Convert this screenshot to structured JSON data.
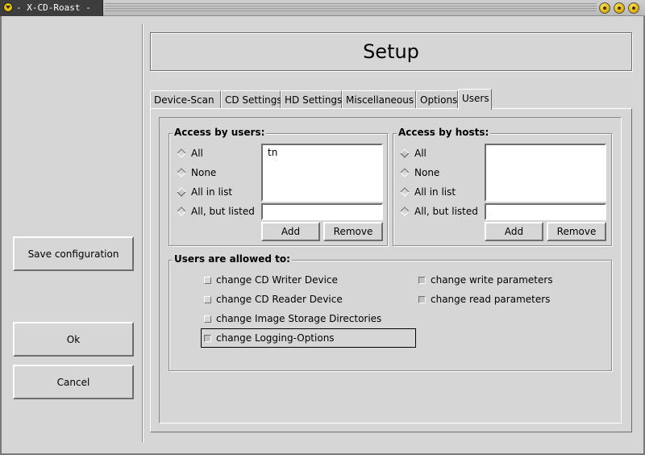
{
  "window": {
    "title": "- X-CD-Roast -"
  },
  "left_panel": {
    "save_label": "Save configuration",
    "ok_label": "Ok",
    "cancel_label": "Cancel"
  },
  "header": {
    "title": "Setup"
  },
  "tabs": [
    {
      "label": "Device-Scan",
      "active": false
    },
    {
      "label": "CD Settings",
      "active": false
    },
    {
      "label": "HD Settings",
      "active": false
    },
    {
      "label": "Miscellaneous",
      "active": false
    },
    {
      "label": "Options",
      "active": false
    },
    {
      "label": "Users",
      "active": true
    }
  ],
  "access_users": {
    "label": "Access by users:",
    "options": [
      "All",
      "None",
      "All in list",
      "All, but listed"
    ],
    "selected": "All in list",
    "list": [
      "tn"
    ],
    "entry_value": "",
    "add_label": "Add",
    "remove_label": "Remove"
  },
  "access_hosts": {
    "label": "Access by hosts:",
    "options": [
      "All",
      "None",
      "All in list",
      "All, but listed"
    ],
    "selected": "All",
    "list": [],
    "entry_value": "",
    "add_label": "Add",
    "remove_label": "Remove"
  },
  "permissions": {
    "label": "Users are allowed to:",
    "items": [
      {
        "label": "change CD Writer Device",
        "checked": false
      },
      {
        "label": "change CD Reader Device",
        "checked": false
      },
      {
        "label": "change Image Storage Directories",
        "checked": false
      },
      {
        "label": "change Logging-Options",
        "checked": true
      },
      {
        "label": "change write parameters",
        "checked": true
      },
      {
        "label": "change read parameters",
        "checked": true
      }
    ]
  }
}
